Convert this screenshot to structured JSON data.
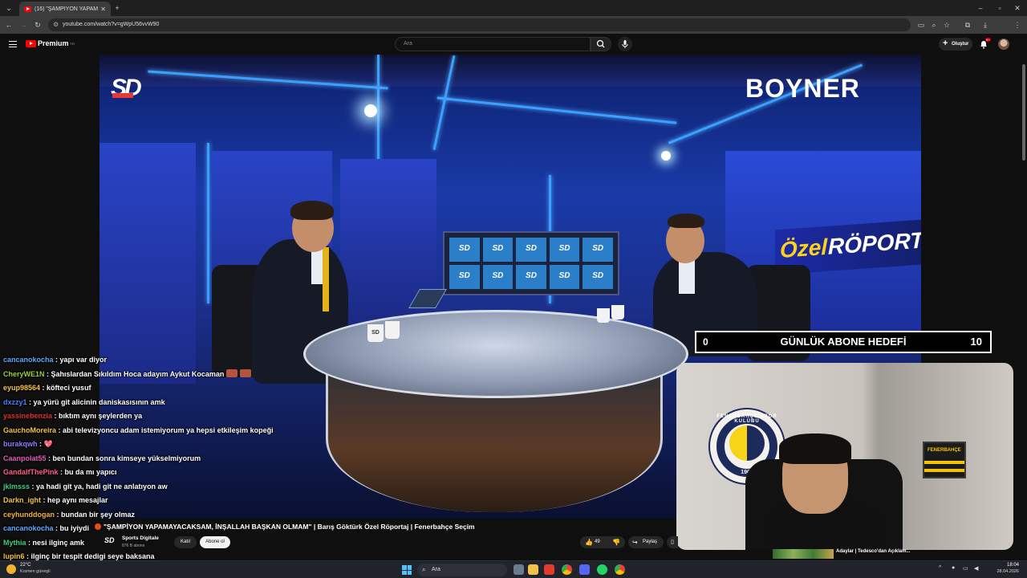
{
  "browser": {
    "tab_title": "(16) \"ŞAMPİYON YAPAMAY...",
    "url": "youtube.com/watch?v=gWpU56vvW90"
  },
  "youtube": {
    "logo_text": "Premium",
    "logo_sup": "TR",
    "search_placeholder": "Ara",
    "create_label": "Oluştur",
    "notif_count": "9+"
  },
  "video_scene": {
    "corner_logo": "SD",
    "sponsor": "BOYNER",
    "banner_part1": "Özel",
    "banner_part2": "RÖPORT",
    "screen_tile": "SD",
    "cup_logo": "SD"
  },
  "goal_overlay": {
    "current": "0",
    "label": "GÜNLÜK ABONE HEDEFİ",
    "target": "10"
  },
  "webcam": {
    "club_ring_text": "FENERBAHÇE SPOR KULÜBÜ",
    "club_year": "1907",
    "scarf_text": "FENERBAHÇE"
  },
  "chat": [
    {
      "user": "cancanokocha",
      "color": "#5fa8ff",
      "msg": "yapı var diyor"
    },
    {
      "user": "CheryWE1N",
      "color": "#9acd32",
      "msg": "Şahıslardan Sıkıldım Hoca adayım Aykut Kocaman",
      "emotes": 2
    },
    {
      "user": "eyup98564",
      "color": "#f5c242",
      "msg": "köfteci yusuf"
    },
    {
      "user": "dxzzy1",
      "color": "#4a7bff",
      "msg": "ya yürü git alicinin daniskasısının amk"
    },
    {
      "user": "yassinebenzia",
      "color": "#e03030",
      "msg": "bıktım aynı şeylerden ya"
    },
    {
      "user": "GauchoMoreira",
      "color": "#f5c242",
      "msg": "abi televizyoncu adam istemiyorum ya hepsi etkileşim kopeği"
    },
    {
      "user": "burakqwh",
      "color": "#8a7dff",
      "msg": "",
      "heart": "💖"
    },
    {
      "user": "Caanpolat55",
      "color": "#e05ab8",
      "msg": "ben bundan sonra kimseye yükselmiyorum"
    },
    {
      "user": "GandalfThePink",
      "color": "#ff5c8a",
      "msg": "bu da mı yapıcı"
    },
    {
      "user": "jklmsss",
      "color": "#3fcf7e",
      "msg": "ya hadi git ya, hadi git ne anlatıyon aw"
    },
    {
      "user": "Darkn_ight",
      "color": "#f5c242",
      "msg": "hep aynı mesajlar"
    },
    {
      "user": "ceyhunddogan",
      "color": "#f5b342",
      "msg": "bundan bir şey olmaz"
    },
    {
      "user": "cancanokocha",
      "color": "#5fa8ff",
      "msg": "bu iyiydi"
    },
    {
      "user": "Mythia",
      "color": "#3fcf7e",
      "msg": "nesi ilginç amk"
    },
    {
      "user": "lupin6",
      "color": "#f5c242",
      "msg": "ilginç bir tespit dedigi seye baksana"
    }
  ],
  "video_info": {
    "title": "\"ŞAMPİYON YAPAMAYACAKSAM, İNŞALLAH BAŞKAN OLMAM\" | Barış Göktürk Özel Röportaj | Fenerbahçe Seçim",
    "channel_name": "Sports Digitale",
    "channel_subs": "876 B abone",
    "join_label": "Katıl",
    "subscribe_label": "Abone ol",
    "likes": "49",
    "share_label": "Paylaş"
  },
  "recommendation": {
    "title": "Adaylar | Tedesco'dan Açıklam..."
  },
  "taskbar": {
    "temp": "22°C",
    "weather": "Kısmen güneşli",
    "search_placeholder": "Ara",
    "time": "18:04",
    "date": "28.04.2026"
  }
}
